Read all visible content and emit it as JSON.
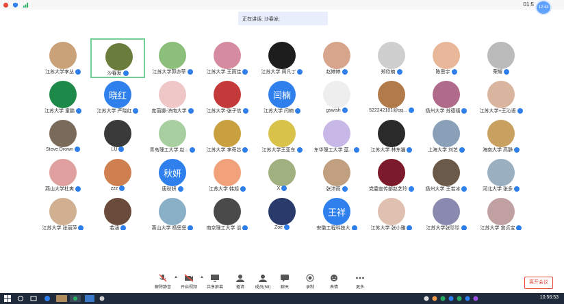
{
  "status_bar": {
    "time": "01:5",
    "badge": "12:44"
  },
  "speaking_banner": "正在讲话: 沙春发;",
  "participants": [
    {
      "name": "江苏大学李丛",
      "color": "#c9a27a"
    },
    {
      "name": "沙春发",
      "color": "#6b7d3c",
      "active": true
    },
    {
      "name": "江苏大学郭亦菲",
      "color": "#8bbf7a"
    },
    {
      "name": "江苏大学 王雨佳",
      "color": "#d68ca0"
    },
    {
      "name": "江苏大学 周凡丁",
      "color": "#1d1d1d"
    },
    {
      "name": "赵婷婷",
      "color": "#d6a58c"
    },
    {
      "name": "郑欣楠",
      "color": "#cfcfcf"
    },
    {
      "name": "陈思宇",
      "color": "#e9b89a"
    },
    {
      "name": "荣耀",
      "color": "#bbbbbb"
    },
    {
      "name": "江苏大学 童鹏",
      "color": "#1e8a4a"
    },
    {
      "name": "江苏大学 严晓红",
      "color": "#2f80ed",
      "text": "晓红"
    },
    {
      "name": "庞丽娜-济南大学",
      "color": "#efc7c7"
    },
    {
      "name": "江苏大学-张子信",
      "color": "#c43a3a"
    },
    {
      "name": "江苏大学 闫楠",
      "color": "#2f80ed",
      "text": "闫楠"
    },
    {
      "name": "gswish",
      "color": "#eeeeee"
    },
    {
      "name": "522242101@qq...",
      "color": "#b07a4a"
    },
    {
      "name": "扬州大学 苏德禧",
      "color": "#b06a8a"
    },
    {
      "name": "江苏大学+王沁语",
      "color": "#d9b5a0"
    },
    {
      "name": "Steve Drown",
      "color": "#7a6a5a"
    },
    {
      "name": "LU",
      "color": "#3a3a3a"
    },
    {
      "name": "青岛理工大学 赵...",
      "color": "#a8cfa0"
    },
    {
      "name": "江苏大学 李奇芯",
      "color": "#c8a040"
    },
    {
      "name": "江苏大学王亚东",
      "color": "#d9c24a"
    },
    {
      "name": "东华理工大学 蓝...",
      "color": "#c7b8e8"
    },
    {
      "name": "江苏大学 林东猫",
      "color": "#2a2a2a"
    },
    {
      "name": "上海大学 刘艺",
      "color": "#8aa0b8"
    },
    {
      "name": "海南大学 高静",
      "color": "#c8a060"
    },
    {
      "name": "燕山大学杜爽",
      "color": "#e0a0a0"
    },
    {
      "name": "zzz",
      "color": "#d08050"
    },
    {
      "name": "唐秋妍",
      "color": "#2f80ed",
      "text": "秋妍"
    },
    {
      "name": "江苏大学 韩旭",
      "color": "#f2a27a"
    },
    {
      "name": "X",
      "color": "#a0b080"
    },
    {
      "name": "张沛雨",
      "color": "#c0a080"
    },
    {
      "name": "党委宣传部赵艺玲",
      "color": "#7a1a2a"
    },
    {
      "name": "扬州大学 王若冰",
      "color": "#6a5a4a"
    },
    {
      "name": "河北大学 张多",
      "color": "#9ab0c0"
    },
    {
      "name": "江苏大学 张丽萍",
      "color": "#d0b090"
    },
    {
      "name": "若涵",
      "color": "#6a4a3a"
    },
    {
      "name": "燕山大学 杨思思",
      "color": "#8ab0c8"
    },
    {
      "name": "南京理工大学 谈",
      "color": "#4a4a4a"
    },
    {
      "name": "Zoe",
      "color": "#2a3a6a"
    },
    {
      "name": "安徽工程科技大",
      "color": "#2f80ed",
      "text": "王祥"
    },
    {
      "name": "江苏大学 张小雅",
      "color": "#e0c0b0"
    },
    {
      "name": "江苏大学张珍珍",
      "color": "#8a8ab0"
    },
    {
      "name": "江苏大学 宫贞宝",
      "color": "#c0a0a0"
    }
  ],
  "toolbar": {
    "items": [
      {
        "label": "解除静音",
        "icon": "mic-muted-icon"
      },
      {
        "label": "开启视频",
        "icon": "camera-off-icon"
      },
      {
        "label": "共享屏幕",
        "icon": "share-screen-icon"
      },
      {
        "label": "邀请",
        "icon": "invite-icon"
      },
      {
        "label": "成员(58)",
        "icon": "members-icon"
      },
      {
        "label": "聊天",
        "icon": "chat-icon"
      },
      {
        "label": "录制",
        "icon": "record-icon"
      },
      {
        "label": "表情",
        "icon": "emoji-icon"
      },
      {
        "label": "更多",
        "icon": "more-icon"
      }
    ],
    "leave_label": "离开会议"
  },
  "taskbar": {
    "time": "10:56:53"
  }
}
